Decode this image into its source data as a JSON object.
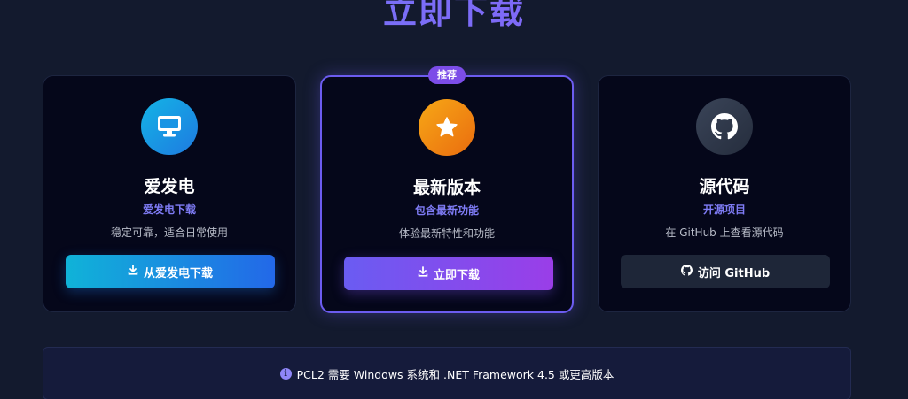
{
  "section": {
    "title": "立即下载"
  },
  "cards": [
    {
      "icon": "monitor-icon",
      "title": "爱发电",
      "subtitle": "爱发电下载",
      "description": "稳定可靠，适合日常使用",
      "button_label": "从爱发电下载",
      "button_icon": "download-icon"
    },
    {
      "badge": "推荐",
      "icon": "star-icon",
      "title": "最新版本",
      "subtitle": "包含最新功能",
      "description": "体验最新特性和功能",
      "button_label": "立即下载",
      "button_icon": "download-icon"
    },
    {
      "icon": "github-icon",
      "title": "源代码",
      "subtitle": "开源项目",
      "description": "在 GitHub 上查看源代码",
      "button_label": "访问 GitHub",
      "button_icon": "github-icon"
    }
  ],
  "notice": {
    "icon": "info-icon",
    "text": "PCL2 需要 Windows 系统和 .NET Framework 4.5 或更高版本"
  },
  "colors": {
    "background": "#131a2e",
    "card_background": "#05071a",
    "accent": "#7f7cf6",
    "featured_border": "#6c5cf0",
    "badge": "#7c4de8"
  }
}
